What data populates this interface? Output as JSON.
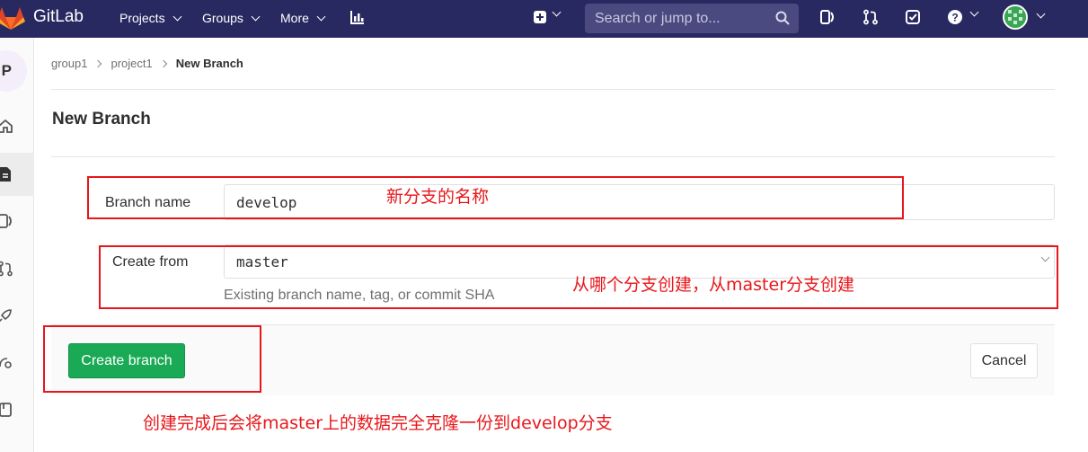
{
  "topbar": {
    "brand": "GitLab",
    "nav": [
      {
        "label": "Projects"
      },
      {
        "label": "Groups"
      },
      {
        "label": "More"
      }
    ],
    "search_placeholder": "Search or jump to...",
    "bg_color": "#292961"
  },
  "sidebar": {
    "project_initial": "P"
  },
  "breadcrumb": {
    "items": [
      "group1",
      "project1",
      "New Branch"
    ]
  },
  "page": {
    "title": "New Branch"
  },
  "form": {
    "branch_name_label": "Branch name",
    "branch_name_value": "develop",
    "create_from_label": "Create from",
    "create_from_value": "master",
    "create_from_help": "Existing branch name, tag, or commit SHA",
    "create_button": "Create branch",
    "cancel_button": "Cancel",
    "accent_color": "#1aaa55"
  },
  "annotations": {
    "note_branch_name": "新分支的名称",
    "note_create_from": "从哪个分支创建，从master分支创建",
    "note_create_button": "创建完成后会将master上的数据完全克隆一份到develop分支",
    "color": "#e8161a"
  }
}
